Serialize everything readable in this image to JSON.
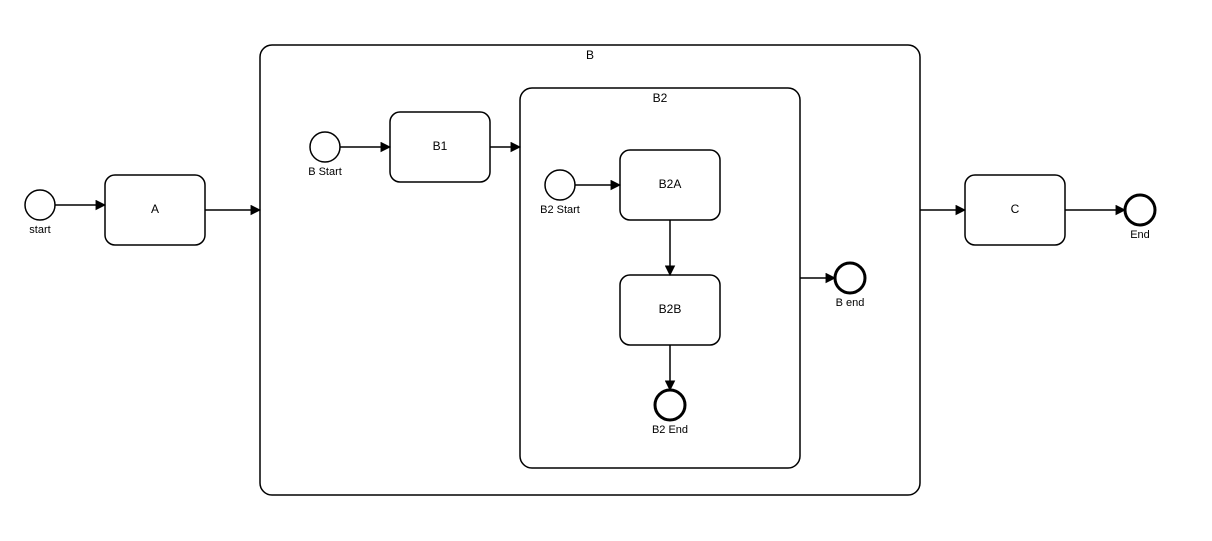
{
  "diagram": {
    "labels": {
      "start": "start",
      "A": "A",
      "B": "B",
      "B_start": "B Start",
      "B1": "B1",
      "B2": "B2",
      "B2_start": "B2 Start",
      "B2A": "B2A",
      "B2B": "B2B",
      "B2_end": "B2 End",
      "B_end": "B end",
      "C": "C",
      "End": "End"
    },
    "nodes": [
      {
        "id": "start",
        "type": "start-event",
        "label_key": "start"
      },
      {
        "id": "A",
        "type": "task",
        "label_key": "A"
      },
      {
        "id": "B",
        "type": "subprocess",
        "label_key": "B"
      },
      {
        "id": "B_start",
        "type": "start-event",
        "label_key": "B_start",
        "parent": "B"
      },
      {
        "id": "B1",
        "type": "task",
        "label_key": "B1",
        "parent": "B"
      },
      {
        "id": "B2",
        "type": "subprocess",
        "label_key": "B2",
        "parent": "B"
      },
      {
        "id": "B2_start",
        "type": "start-event",
        "label_key": "B2_start",
        "parent": "B2"
      },
      {
        "id": "B2A",
        "type": "task",
        "label_key": "B2A",
        "parent": "B2"
      },
      {
        "id": "B2B",
        "type": "task",
        "label_key": "B2B",
        "parent": "B2"
      },
      {
        "id": "B2_end",
        "type": "end-event",
        "label_key": "B2_end",
        "parent": "B2"
      },
      {
        "id": "B_end",
        "type": "end-event",
        "label_key": "B_end",
        "parent": "B"
      },
      {
        "id": "C",
        "type": "task",
        "label_key": "C"
      },
      {
        "id": "End",
        "type": "end-event",
        "label_key": "End"
      }
    ],
    "flows": [
      {
        "from": "start",
        "to": "A"
      },
      {
        "from": "A",
        "to": "B"
      },
      {
        "from": "B_start",
        "to": "B1"
      },
      {
        "from": "B1",
        "to": "B2"
      },
      {
        "from": "B2_start",
        "to": "B2A"
      },
      {
        "from": "B2A",
        "to": "B2B"
      },
      {
        "from": "B2B",
        "to": "B2_end"
      },
      {
        "from": "B2",
        "to": "B_end"
      },
      {
        "from": "B",
        "to": "C"
      },
      {
        "from": "C",
        "to": "End"
      }
    ]
  }
}
